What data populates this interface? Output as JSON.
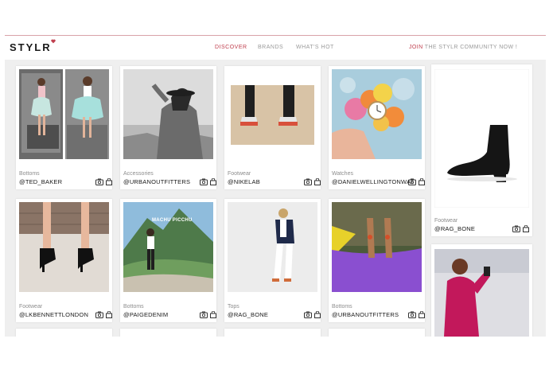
{
  "header": {
    "logo": "STYLR",
    "nav": [
      {
        "label": "DISCOVER"
      },
      {
        "label": "BRANDS"
      },
      {
        "label": "WHAT'S HOT"
      }
    ],
    "join_highlight": "JOIN",
    "join_rest": " THE STYLR COMMUNITY NOW !"
  },
  "colors": {
    "accent": "#c0404f",
    "background": "#efefef"
  },
  "posts": [
    {
      "category": "Bottoms",
      "user": "@TED_BAKER"
    },
    {
      "category": "Accessories",
      "user": "@URBANOUTFITTERS"
    },
    {
      "category": "Footwear",
      "user": "@NIKELAB"
    },
    {
      "category": "Watches",
      "user": "@DANIELWELLINGTONWAT"
    },
    {
      "category": "Footwear",
      "user": "@RAG_BONE"
    },
    {
      "category": "Footwear",
      "user": "@LKBENNETTLONDON"
    },
    {
      "category": "Bottoms",
      "user": "@PAIGEDENIM"
    },
    {
      "category": "Tops",
      "user": "@RAG_BONE"
    },
    {
      "category": "Bottoms",
      "user": "@URBANOUTFITTERS"
    }
  ],
  "image_text": {
    "machu_picchu": "MACHU PICCHU"
  },
  "icons": [
    "camera-icon",
    "bag-icon"
  ]
}
